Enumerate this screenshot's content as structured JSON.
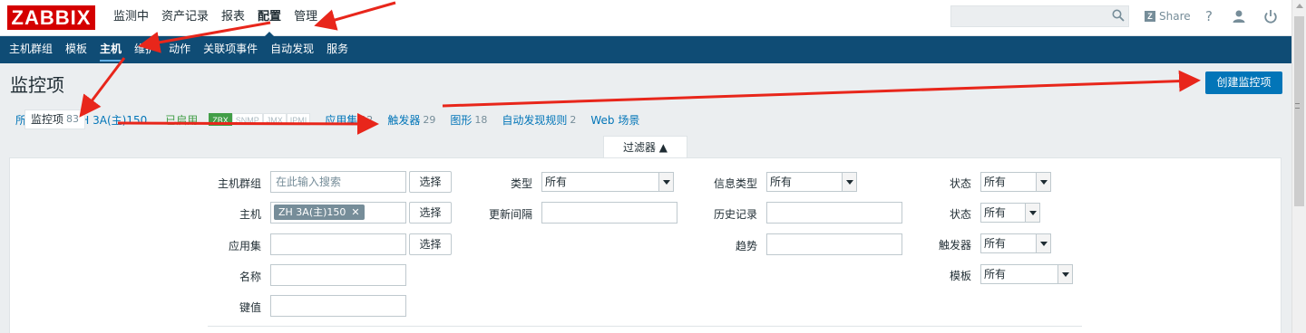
{
  "logo": "ZABBIX",
  "main_nav": [
    "监测中",
    "资产记录",
    "报表",
    "配置",
    "管理"
  ],
  "main_nav_active": "配置",
  "header_tools": {
    "share": "Share",
    "help": "?"
  },
  "sub_nav": [
    "主机群组",
    "模板",
    "主机",
    "维护",
    "动作",
    "关联项事件",
    "自动发现",
    "服务"
  ],
  "sub_nav_active": "主机",
  "page_title": "监控项",
  "create_button": "创建监控项",
  "host_nav": {
    "all_hosts": "所有主机",
    "separator": "/",
    "host": "ZH 3A(主)150",
    "status": "已启用",
    "availability": [
      "ZBX",
      "SNMP",
      "JMX",
      "IPMI"
    ],
    "tabs": [
      {
        "label": "应用集",
        "count": "12"
      },
      {
        "label": "监控项",
        "count": "83"
      },
      {
        "label": "触发器",
        "count": "29"
      },
      {
        "label": "图形",
        "count": "18"
      },
      {
        "label": "自动发现规则",
        "count": "2"
      },
      {
        "label": "Web 场景",
        "count": ""
      }
    ]
  },
  "filter": {
    "tab_label": "过滤器 ▲",
    "host_group_label": "主机群组",
    "host_group_placeholder": "在此输入搜索",
    "select_label": "选择",
    "host_label": "主机",
    "host_chip": "ZH 3A(主)150",
    "application_label": "应用集",
    "name_label": "名称",
    "key_label": "键值",
    "type_label": "类型",
    "type_value": "所有",
    "update_interval_label": "更新间隔",
    "info_type_label": "信息类型",
    "info_type_value": "所有",
    "history_label": "历史记录",
    "trends_label": "趋势",
    "state_label": "状态",
    "state_value": "所有",
    "status_label": "状态",
    "status_value": "所有",
    "triggers_label": "触发器",
    "triggers_value": "所有",
    "template_label": "模板",
    "template_value": "所有"
  },
  "annotation_color": "#e8261b"
}
